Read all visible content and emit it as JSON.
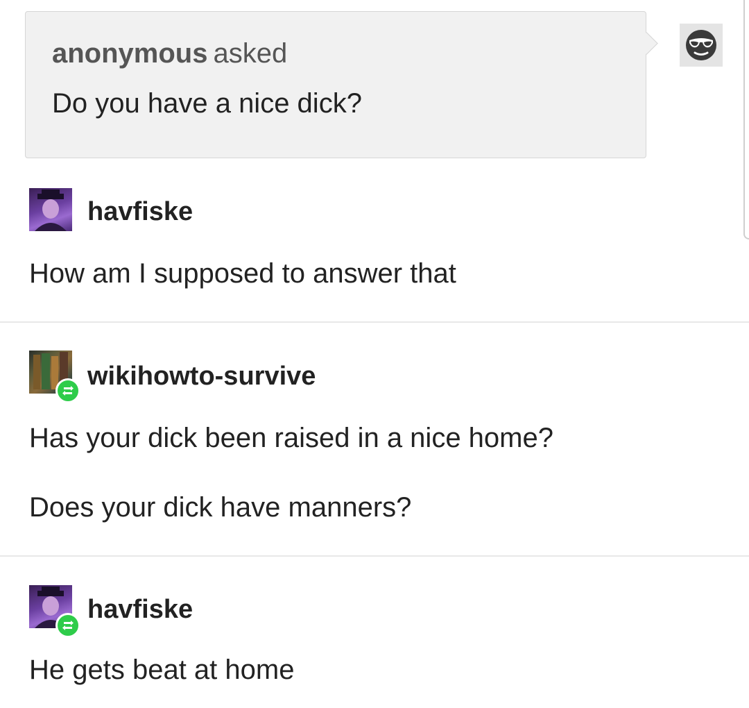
{
  "ask": {
    "asker": "anonymous",
    "asked_label": "asked",
    "question": "Do you have a nice dick?",
    "avatar_icon": "sunglasses-face-icon"
  },
  "posts": [
    {
      "username": "havfiske",
      "paragraphs": [
        "How am I supposed to answer that"
      ],
      "reblog_badge": false
    },
    {
      "username": "wikihowto-survive",
      "paragraphs": [
        "Has your dick been raised in a nice home?",
        "Does your dick have manners?"
      ],
      "reblog_badge": true
    },
    {
      "username": "havfiske",
      "paragraphs": [
        "He gets beat at home"
      ],
      "reblog_badge": true
    }
  ],
  "colors": {
    "ask_background": "#f1f1f1",
    "reblog_badge": "#2ecc4a",
    "text": "#222222",
    "muted_text": "#555555"
  }
}
